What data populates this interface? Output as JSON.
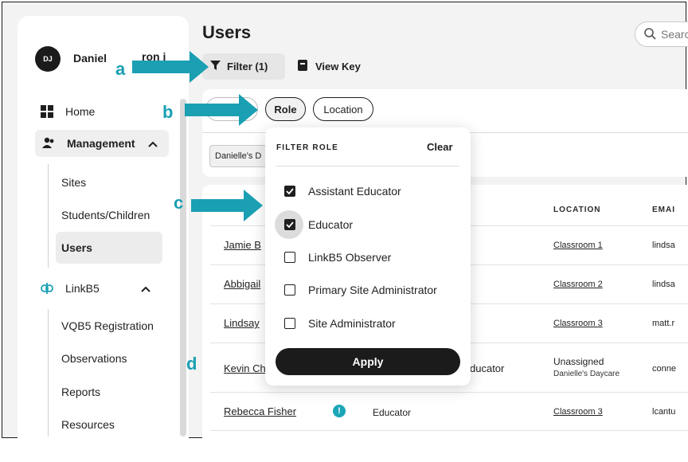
{
  "sidebar": {
    "avatar_initials": "DJ",
    "user_name": "Daniel",
    "user_name_tail": "ron i",
    "items": [
      {
        "label": "Home",
        "icon": "grid-icon"
      },
      {
        "label": "Management",
        "icon": "people-icon"
      },
      {
        "label": "LinkB5",
        "icon": "link-icon"
      }
    ],
    "management_sub": [
      "Sites",
      "Students/Children",
      "Users"
    ],
    "linkb5_sub": [
      "VQB5 Registration",
      "Observations",
      "Reports",
      "Resources"
    ]
  },
  "header": {
    "title": "Users",
    "search_placeholder": "Searc"
  },
  "toolbar": {
    "filter_label": "Filter (1)",
    "view_key_label": "View Key"
  },
  "chips": [
    "Role",
    "Location"
  ],
  "active_tag": "Danielle's D",
  "table": {
    "headers": [
      "LOCATION",
      "EMAI"
    ],
    "rows": [
      {
        "name": "Jamie B",
        "role": "",
        "location": "Classroom 1",
        "email": "lindsa"
      },
      {
        "name": "Abbigail",
        "role": "",
        "location": "Classroom 2",
        "email": "lindsa"
      },
      {
        "name": "Lindsay",
        "role": "",
        "location": "Classroom 3",
        "email": "matt.r"
      },
      {
        "name": "Kevin Ch",
        "role": "ducator",
        "location": "Unassigned",
        "location_sub": "Danielle's Daycare",
        "email": "conne"
      },
      {
        "name": "Rebecca Fisher",
        "role": "Educator",
        "location": "Classroom 3",
        "email": "lcantu"
      }
    ]
  },
  "filter_dropdown": {
    "title": "FILTER ROLE",
    "clear_label": "Clear",
    "options": [
      {
        "label": "Assistant Educator",
        "checked": true
      },
      {
        "label": "Educator",
        "checked": true
      },
      {
        "label": "LinkB5 Observer",
        "checked": false
      },
      {
        "label": "Primary Site Administrator",
        "checked": false
      },
      {
        "label": "Site Administrator",
        "checked": false
      }
    ],
    "apply_label": "Apply"
  },
  "callouts": [
    "a",
    "b",
    "c",
    "d"
  ],
  "colors": {
    "accent": "#1a9fb3",
    "dark": "#1b1b1b"
  }
}
